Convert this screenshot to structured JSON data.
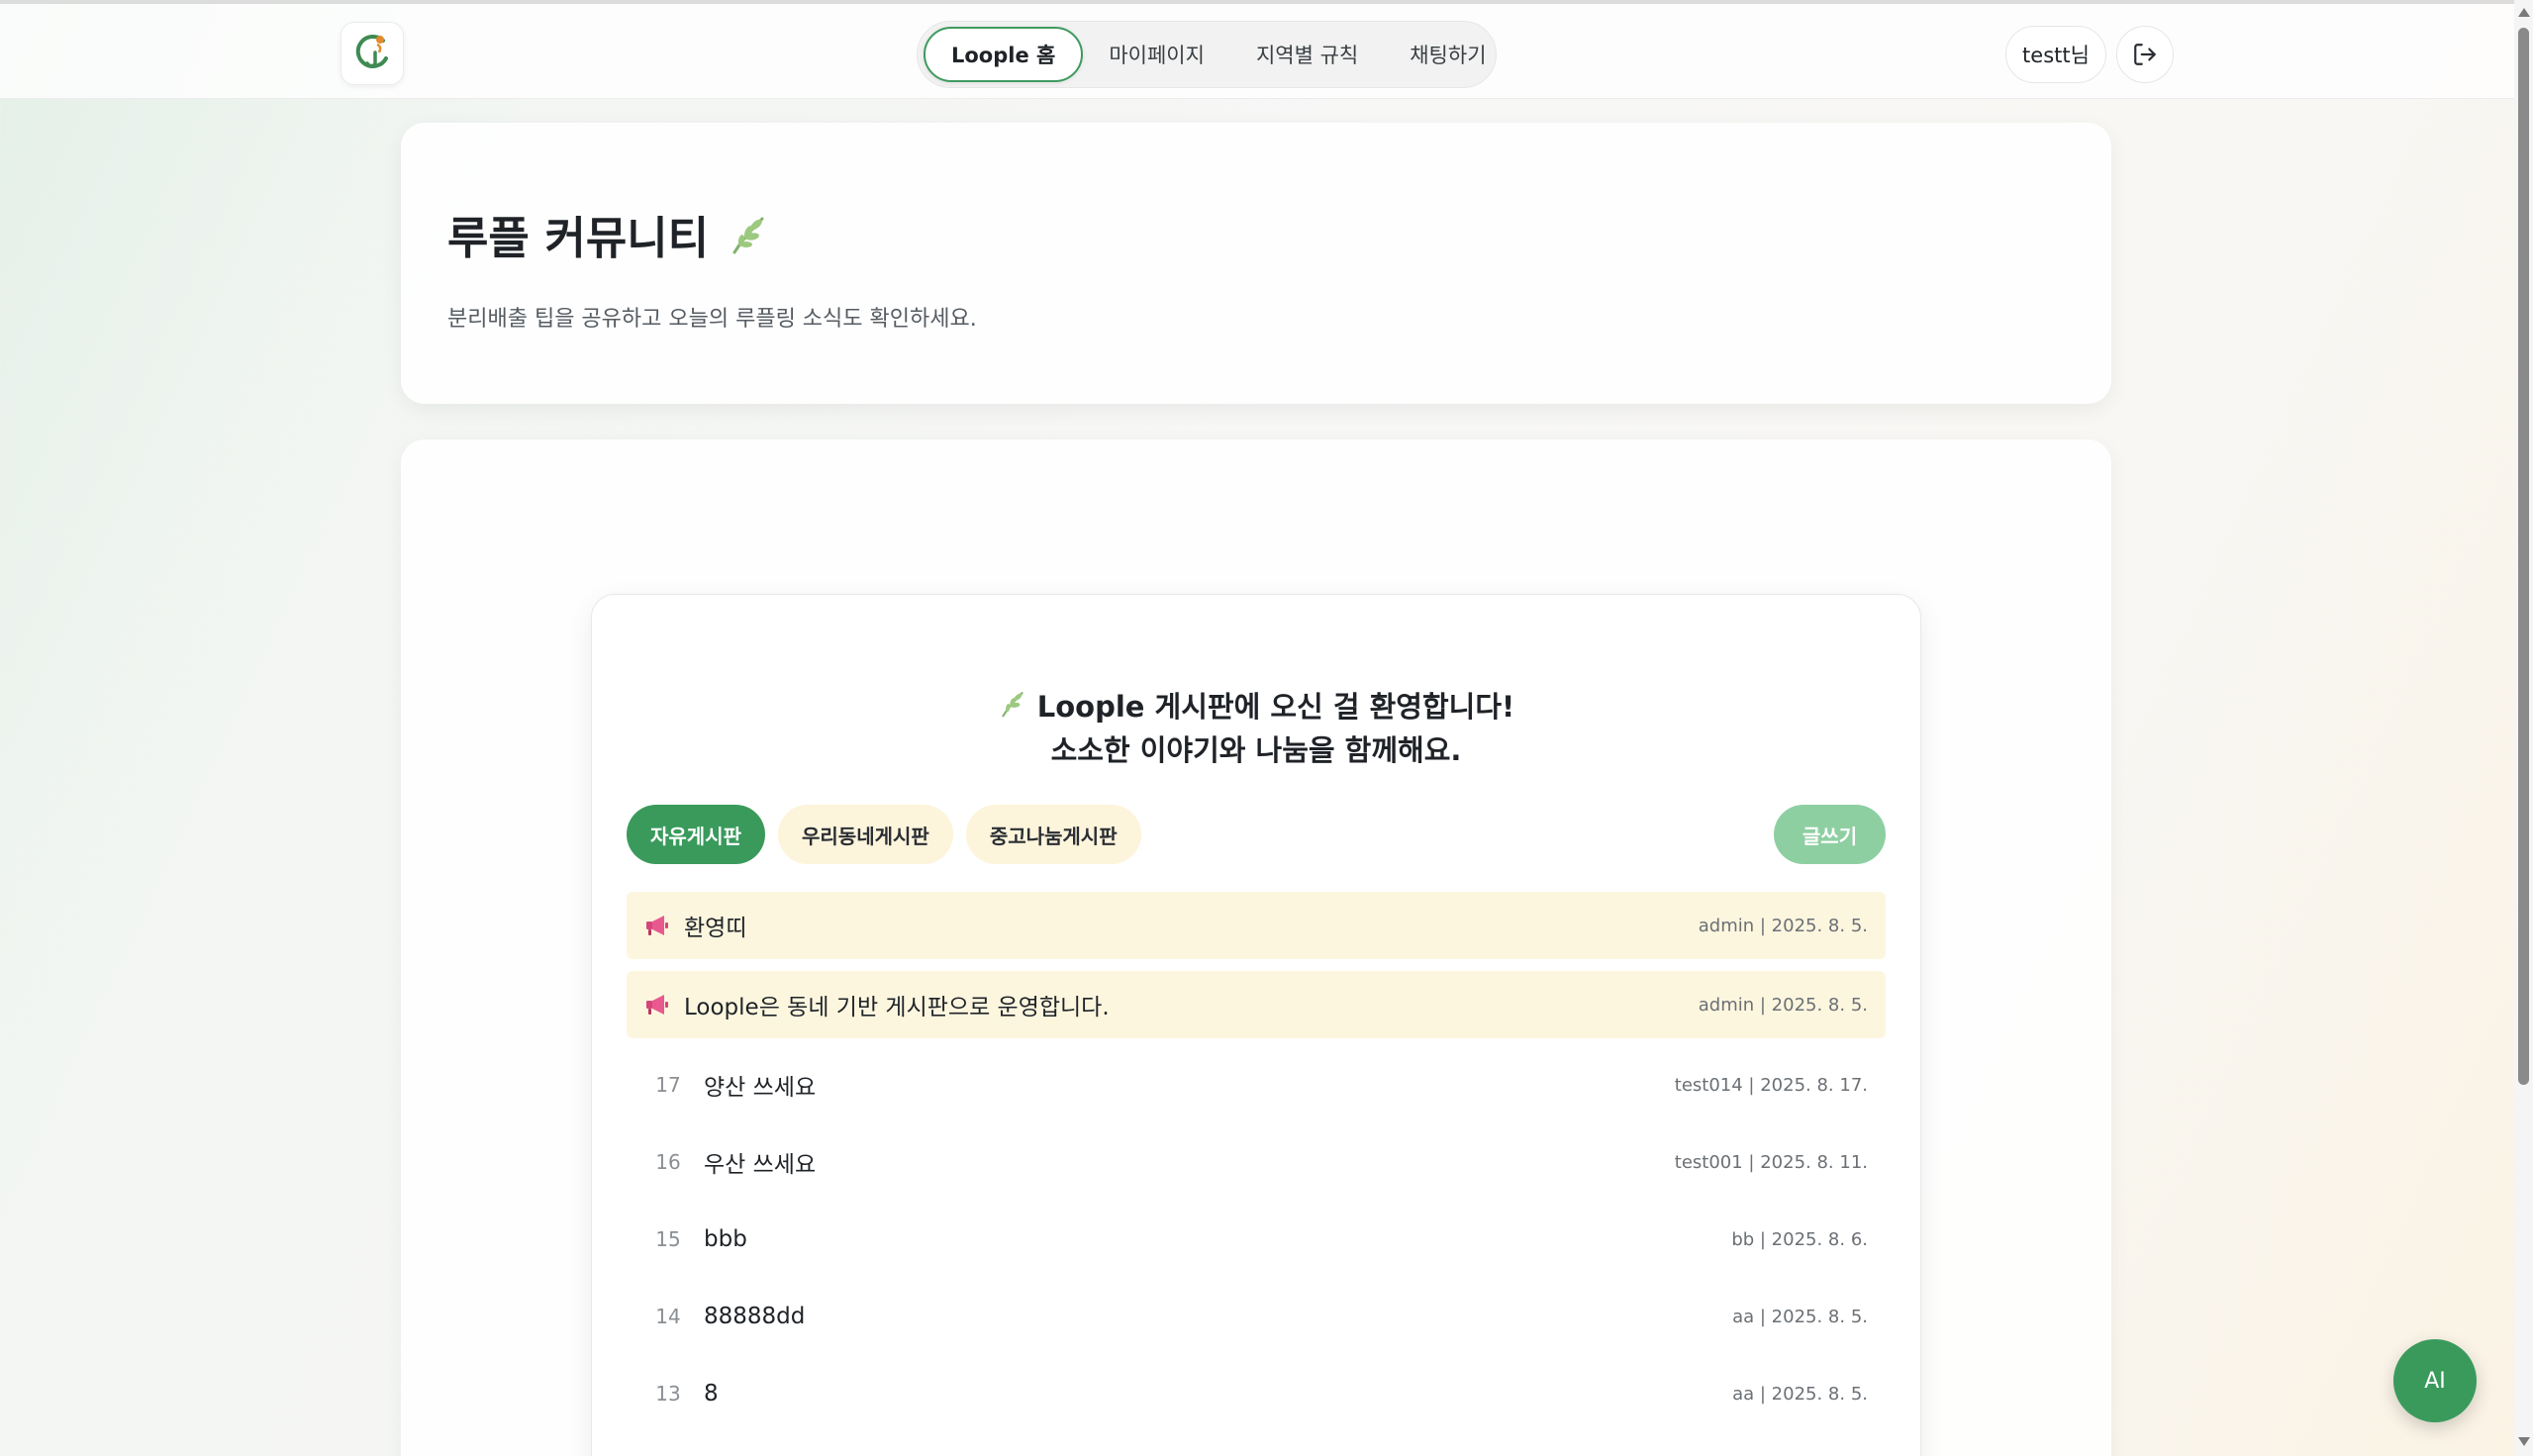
{
  "header": {
    "logo_icon": "loople-logo-icon",
    "nav": [
      {
        "label": "Loople 홈",
        "active": true
      },
      {
        "label": "마이페이지",
        "active": false
      },
      {
        "label": "지역별 규칙",
        "active": false
      },
      {
        "label": "채팅하기",
        "active": false
      }
    ],
    "user_label": "testt님",
    "logout_icon": "logout-icon"
  },
  "hero": {
    "title": "루플 커뮤니티",
    "title_icon": "leaf-icon",
    "subtitle": "분리배출 팁을 공유하고 오늘의 루플링 소식도 확인하세요."
  },
  "board": {
    "welcome_line1": "Loople 게시판에 오신 걸 환영합니다!",
    "welcome_line2": "소소한 이야기와 나눔을 함께해요.",
    "tabs": [
      {
        "label": "자유게시판",
        "active": true
      },
      {
        "label": "우리동네게시판",
        "active": false
      },
      {
        "label": "중고나눔게시판",
        "active": false
      }
    ],
    "write_label": "글쓰기",
    "notices": [
      {
        "title": "환영띠",
        "meta": "admin | 2025. 8. 5."
      },
      {
        "title": "Loople은 동네 기반 게시판으로 운영합니다.",
        "meta": "admin | 2025. 8. 5."
      }
    ],
    "posts": [
      {
        "num": "17",
        "title": "양산 쓰세요",
        "meta": "test014 | 2025. 8. 17."
      },
      {
        "num": "16",
        "title": "우산 쓰세요",
        "meta": "test001 | 2025. 8. 11."
      },
      {
        "num": "15",
        "title": "bbb",
        "meta": "bb | 2025. 8. 6."
      },
      {
        "num": "14",
        "title": "88888dd",
        "meta": "aa | 2025. 8. 5."
      },
      {
        "num": "13",
        "title": "8",
        "meta": "aa | 2025. 8. 5."
      }
    ]
  },
  "ai_fab_label": "AI",
  "colors": {
    "accent": "#3a9a5c",
    "accent_light": "#8ecfa2",
    "notice_bg": "#fdf6df",
    "tab_bg": "#fdf4dc"
  }
}
